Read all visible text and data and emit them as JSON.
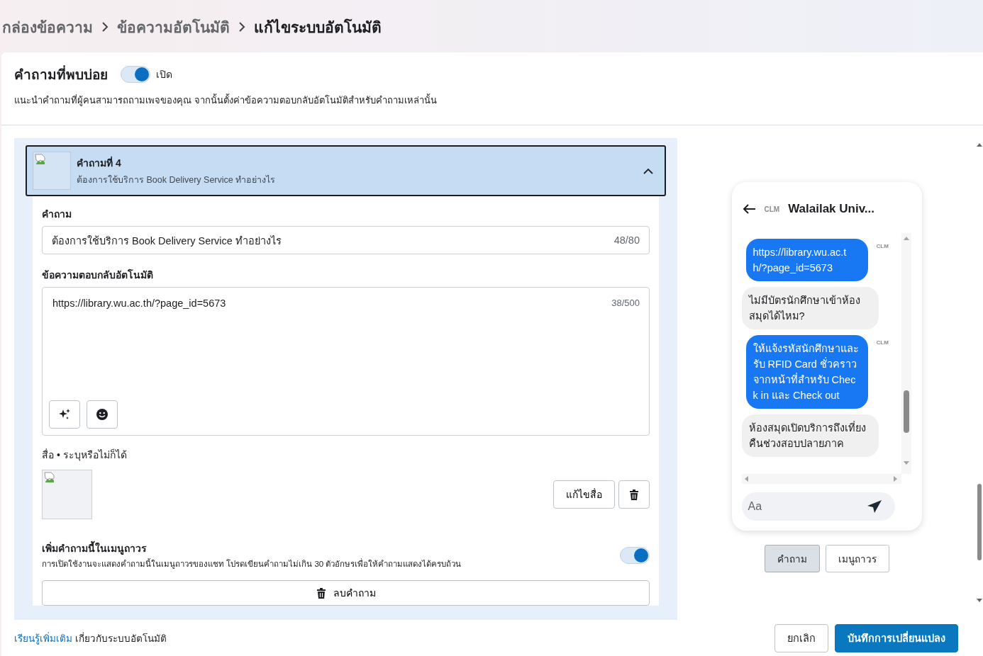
{
  "breadcrumb": [
    {
      "label": "กล่องข้อความ",
      "current": false
    },
    {
      "label": "ข้อความอัตโนมัติ",
      "current": false
    },
    {
      "label": "แก้ไขระบบอัตโนมัติ",
      "current": true
    }
  ],
  "faq": {
    "title": "คำถามที่พบบ่อย",
    "on": true,
    "toggle_label": "เปิด",
    "description": "แนะนำคำถามที่ผู้คนสามารถถามเพจของคุณ จากนั้นตั้งค่าข้อความตอบกลับอัตโนมัติสำหรับคำถามเหล่านั้น"
  },
  "question_card": {
    "title": "คำถามที่ 4",
    "subtitle": "ต้องการใช้บริการ Book Delivery Service ทำอย่างไร",
    "expanded": true,
    "question_label": "คำถาม",
    "question_value": "ต้องการใช้บริการ Book Delivery Service ทำอย่างไร",
    "question_count": "48/80",
    "reply_label": "ข้อความตอบกลับอัตโนมัติ",
    "reply_value": "https://library.wu.ac.th/?page_id=5673",
    "reply_count": "38/500",
    "media_label": "สื่อ • ระบุหรือไม่ก็ได้",
    "edit_media_button": "แก้ไขสื่อ",
    "menu_title": "เพิ่มคำถามนี้ในเมนูถาวร",
    "menu_description": "การเปิดใช้งานจะแสดงคำถามนี้ในเมนูถาวรของแชท โปรดเขียนคำถามไม่เกิน 30 ตัวอักษรเพื่อให้คำถามแสดงได้ครบถ้วน",
    "menu_on": true,
    "delete_button": "ลบคำถาม"
  },
  "preview": {
    "title": "Walailak Univ...",
    "logo_text": "CLM",
    "messages": [
      {
        "kind": "reply",
        "text": "https://library.wu.ac.th/?page_id=5673",
        "avatar": "CLM"
      },
      {
        "kind": "question",
        "text": "ไม่มีบัตรนักศึกษาเข้าห้องสมุดได้ไหม?"
      },
      {
        "kind": "reply",
        "text": "ให้แจ้งรหัสนักศึกษาและรับ RFID Card ชั่วคราวจากหน้าที่สำหรับ Check in และ Check out",
        "avatar": "CLM"
      },
      {
        "kind": "question",
        "text": "ห้องสมุดเปิดบริการถึงเที่ยงคืนช่วงสอบปลายภาค"
      }
    ],
    "input_placeholder": "Aa",
    "tabs": [
      {
        "label": "คำถาม",
        "selected": true
      },
      {
        "label": "เมนูถาวร",
        "selected": false
      }
    ]
  },
  "footer": {
    "link": "เรียนรู้เพิ่มเติม",
    "text": "เกี่ยวกับระบบอัตโนมัติ",
    "buttons": [
      {
        "label": "ยกเลิก",
        "kind": "secondary"
      },
      {
        "label": "บันทึกการเปลี่ยนแปลง",
        "kind": "primary"
      }
    ]
  }
}
